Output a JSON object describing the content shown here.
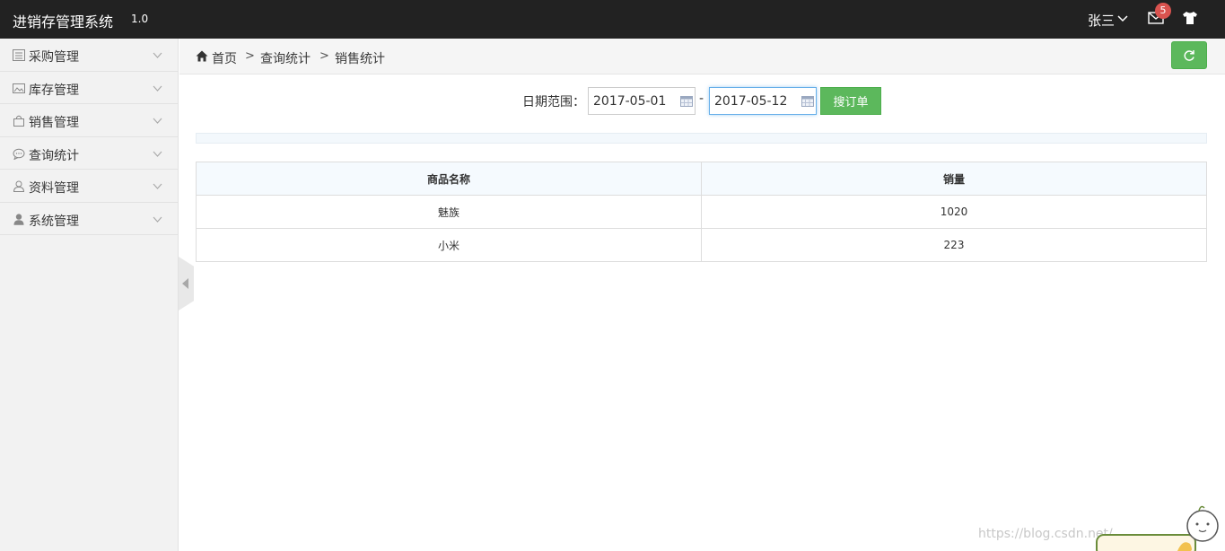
{
  "app": {
    "title": "进销存管理系统",
    "version": "1.0"
  },
  "header": {
    "user_name": "张三",
    "mail_count": "5"
  },
  "sidebar": {
    "items": [
      {
        "label": "采购管理",
        "icon": "list-icon"
      },
      {
        "label": "库存管理",
        "icon": "image-icon"
      },
      {
        "label": "销售管理",
        "icon": "bag-icon"
      },
      {
        "label": "查询统计",
        "icon": "comment-icon"
      },
      {
        "label": "资料管理",
        "icon": "user-outline-icon"
      },
      {
        "label": "系统管理",
        "icon": "user-icon"
      }
    ]
  },
  "breadcrumb": {
    "home": "首页",
    "sep": ">",
    "level1": "查询统计",
    "level2": "销售统计"
  },
  "search": {
    "date_label": "日期范围：",
    "start_date": "2017-05-01",
    "end_date": "2017-05-12",
    "separator": "-",
    "button_label": "搜订单"
  },
  "table": {
    "columns": [
      "商品名称",
      "销量"
    ],
    "rows": [
      [
        "魅族",
        "1020"
      ],
      [
        "小米",
        "223"
      ]
    ]
  },
  "watermark": "https://blog.csdn.net/",
  "colors": {
    "topbar": "#222222",
    "success": "#5cb85c",
    "badge": "#d9534f"
  }
}
